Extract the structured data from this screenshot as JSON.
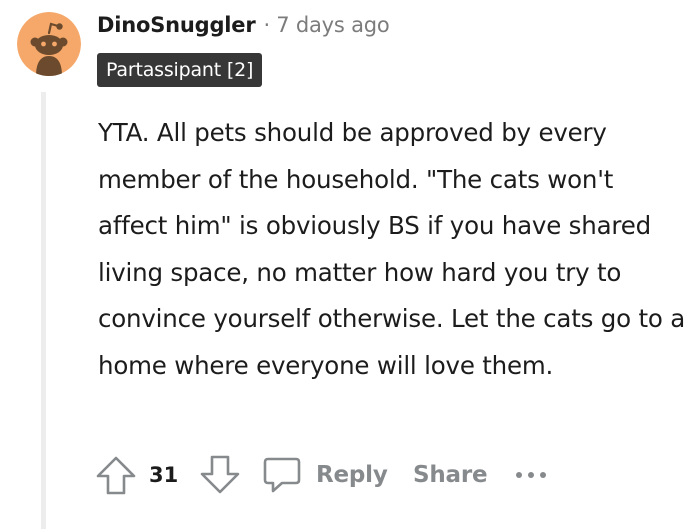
{
  "comment": {
    "author": "DinoSnuggler",
    "separator": "·",
    "timestamp": "7 days ago",
    "flair": "Partassipant [2]",
    "body": "YTA. All pets should be approved by every member of the household. \"The cats won't affect him\" is obviously BS if you have shared living space, no matter how hard you try to convince yourself otherwise. Let the cats go to a home where everyone will love them.",
    "score": "31",
    "actions": {
      "reply_label": "Reply",
      "share_label": "Share"
    }
  },
  "icons": {
    "avatar": "snoo-avatar-icon",
    "upvote": "upvote-arrow-icon",
    "downvote": "downvote-arrow-icon",
    "reply": "comment-bubble-icon",
    "more": "more-horizontal-icon"
  },
  "colors": {
    "avatar_bg": "#f5a869",
    "text": "#1c1c1c",
    "muted": "#7c7c7c",
    "action_gray": "#878a8c",
    "flair_bg": "#373737",
    "thread_line": "#ededed"
  }
}
